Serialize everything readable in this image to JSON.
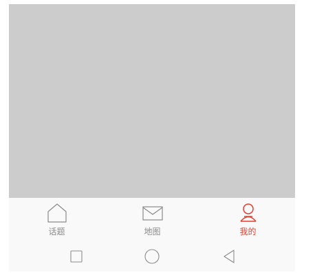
{
  "tabbar": {
    "tabs": [
      {
        "label": "话题",
        "icon": "home-icon",
        "active": false
      },
      {
        "label": "地图",
        "icon": "mail-icon",
        "active": false
      },
      {
        "label": "我的",
        "icon": "user-icon",
        "active": true
      }
    ]
  },
  "colors": {
    "content_placeholder": "#cccccc",
    "tab_inactive": "#8a8a8a",
    "tab_active": "#e83d2e",
    "bar_background": "#f9f9f9"
  },
  "system_nav": {
    "buttons": [
      "recent-apps-icon",
      "home-circle-icon",
      "back-triangle-icon"
    ]
  }
}
